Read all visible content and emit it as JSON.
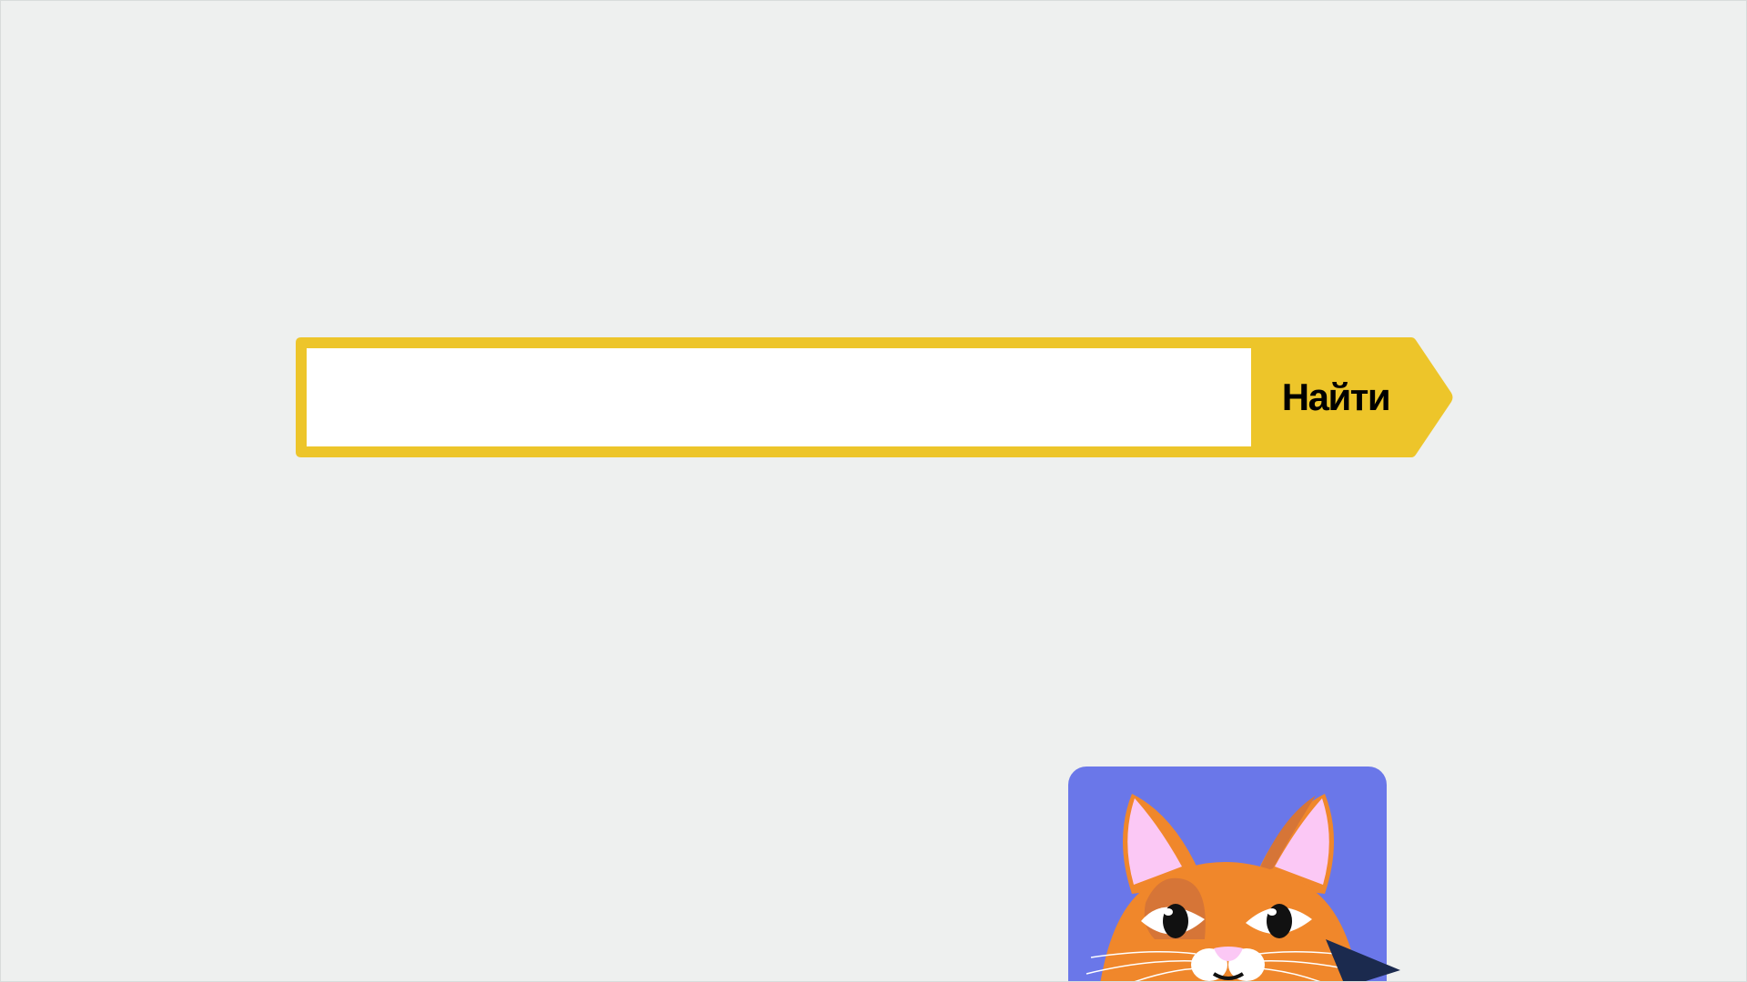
{
  "search": {
    "value": "",
    "placeholder": "",
    "button_label": "Найти"
  },
  "colors": {
    "background": "#eef0ef",
    "accent_yellow": "#edc52a",
    "input_bg": "#ffffff",
    "card_bg": "#6a77e9",
    "cat_orange": "#f0872b",
    "cat_dark_orange": "#d67537",
    "cat_ear_pink": "#fbc8f5",
    "cursor": "#1b2a4e"
  },
  "icons": {
    "illustration": "cat-face-icon",
    "cursor": "mouse-cursor-icon"
  }
}
